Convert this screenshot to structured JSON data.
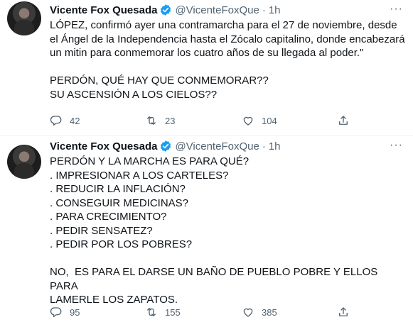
{
  "tweets": [
    {
      "name": "Vicente Fox Quesada",
      "handle": "@VicenteFoxQue",
      "time": "1h",
      "text": "LÓPEZ, confirmó ayer una contramarcha para el 27 de noviembre, desde\nel Ángel de la Independencia hasta el Zócalo capitalino, donde encabezará\nun mitin para conmemorar los cuatro años de su llegada al poder.\"\n\nPERDÓN, QUÉ HAY QUE CONMEMORAR??\nSU ASCENSIÓN A LOS CIELOS??",
      "replies": "42",
      "retweets": "23",
      "likes": "104"
    },
    {
      "name": "Vicente Fox Quesada",
      "handle": "@VicenteFoxQue",
      "time": "1h",
      "text": "PERDÓN Y LA MARCHA ES PARA QUÉ?\n. IMPRESIONAR A LOS CARTELES?\n. REDUCIR LA INFLACIÓN?\n. CONSEGUIR MEDICINAS?\n. PARA CRECIMIENTO?\n. PEDIR SENSATEZ?\n. PEDIR POR LOS POBRES?\n\nNO,  ES PARA EL DARSE UN BAÑO DE PUEBLO POBRE Y ELLOS PARA\nLAMERLE LOS ZAPATOS.",
      "replies": "95",
      "retweets": "155",
      "likes": "385"
    }
  ],
  "colors": {
    "verified": "#1d9bf0",
    "muted": "#536471",
    "text": "#0f1419",
    "divider": "#eff3f4"
  },
  "icons": [
    "more-icon",
    "verified-badge-icon",
    "reply-icon",
    "retweet-icon",
    "like-icon",
    "share-icon"
  ]
}
